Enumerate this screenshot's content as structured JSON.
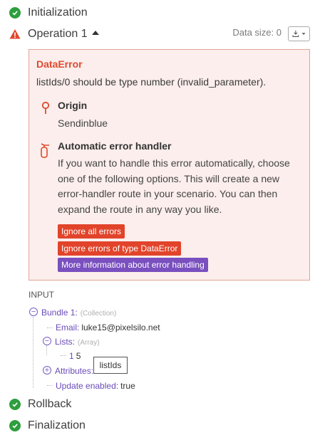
{
  "steps": {
    "initialization": "Initialization",
    "operation": "Operation 1",
    "rollback": "Rollback",
    "finalization": "Finalization"
  },
  "operation": {
    "data_size": "Data size: 0"
  },
  "error": {
    "title": "DataError",
    "message": "listIds/0 should be type number (invalid_parameter).",
    "origin_title": "Origin",
    "origin_value": "Sendinblue",
    "handler_title": "Automatic error handler",
    "handler_text": "If you want to handle this error automatically, choose one of the following options. This will create a new error-handler route in your scenario. You can then expand the route in any way you like.",
    "buttons": {
      "ignore_all": "Ignore all errors",
      "ignore_type": "Ignore errors of type DataError",
      "more_info": "More information about error handling"
    }
  },
  "input": {
    "heading": "INPUT",
    "bundle_key": "Bundle 1:",
    "bundle_type": "(Collection)",
    "email_key": "Email:",
    "email_value": "luke15@pixelsilo.net",
    "lists_key": "Lists:",
    "lists_type": "(Array)",
    "list_index": "1",
    "list_value": "5",
    "attributes_key": "Attributes:",
    "update_key": "Update enabled:",
    "update_value": "true",
    "tooltip": "listIds"
  },
  "colors": {
    "success": "#2e9e3e",
    "error": "#e0492f",
    "error_bg": "#fbeeec",
    "accent_purple": "#7a4fbf"
  }
}
